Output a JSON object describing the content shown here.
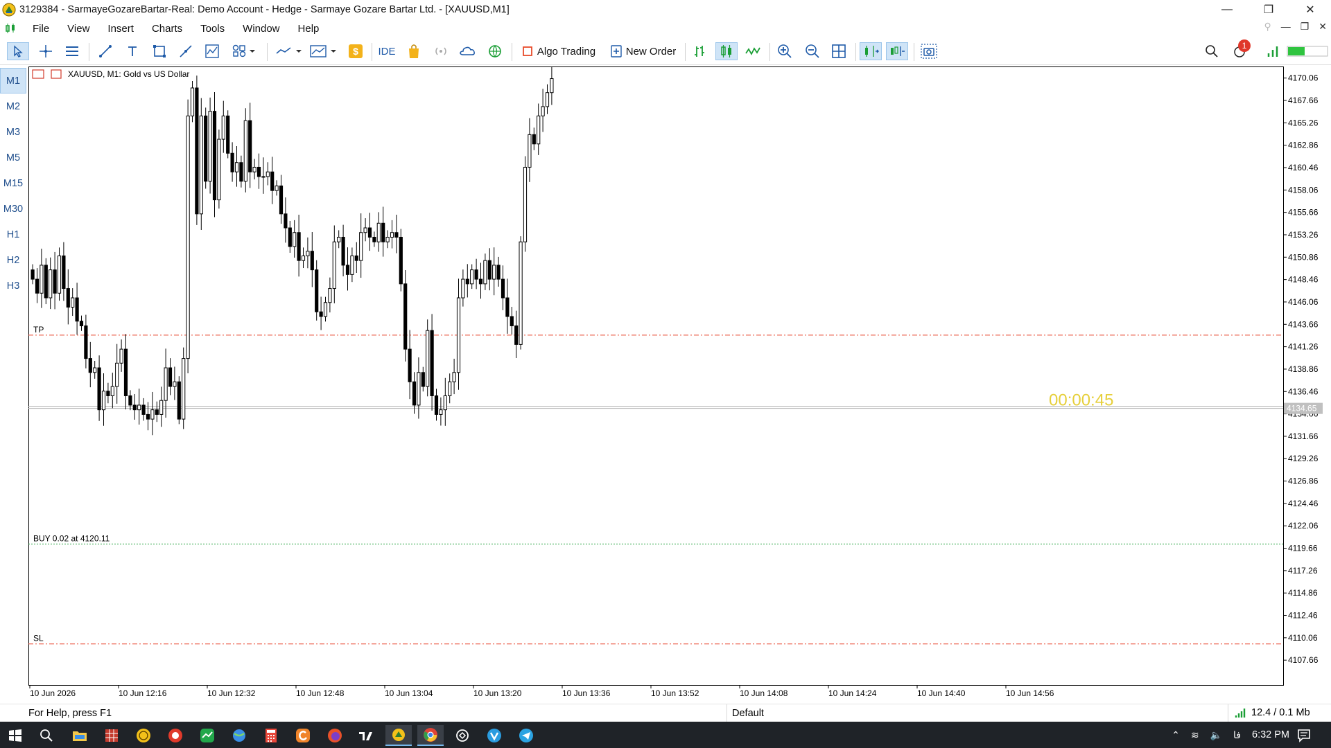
{
  "window": {
    "title": "3129384 - SarmayeGozareBartar-Real: Demo Account - Hedge - Sarmaye Gozare Bartar Ltd. - [XAUUSD,M1]",
    "minimize": "—",
    "maximize": "❐",
    "close": "✕"
  },
  "menu": {
    "items": [
      "File",
      "View",
      "Insert",
      "Charts",
      "Tools",
      "Window",
      "Help"
    ],
    "mdi": [
      "—",
      "❐",
      "✕"
    ]
  },
  "toolbar": {
    "ide_label": "IDE",
    "algo_label": "Algo Trading",
    "neworder_label": "New Order",
    "notification_count": "1"
  },
  "timeframes": {
    "items": [
      "M1",
      "M2",
      "M3",
      "M5",
      "M15",
      "M30",
      "H1",
      "H2",
      "H3"
    ],
    "active": "M1"
  },
  "chart": {
    "symbol_label": "XAUUSD, M1:  Gold vs US Dollar",
    "countdown": "00:00:45",
    "bid_label": "4134.65",
    "tp_label": "TP",
    "sl_label": "SL",
    "buy_label": "BUY 0.02 at 4120.11",
    "colors": {
      "tp_sl": "#e8412a",
      "buy": "#1a9e35",
      "countdown": "#e6cf3a",
      "candle": "#000000"
    }
  },
  "chart_data": {
    "type": "candlestick",
    "ylim": [
      4105.0,
      4171.3
    ],
    "price_ticks": [
      "4170.06",
      "4167.66",
      "4165.26",
      "4162.86",
      "4160.46",
      "4158.06",
      "4155.66",
      "4153.26",
      "4150.86",
      "4148.46",
      "4146.06",
      "4143.66",
      "4141.26",
      "4138.86",
      "4136.46",
      "4134.06",
      "4131.66",
      "4129.26",
      "4126.86",
      "4124.46",
      "4122.06",
      "4119.66",
      "4117.26",
      "4114.86",
      "4112.46",
      "4110.06",
      "4107.66"
    ],
    "time_ticks": [
      "10 Jun 2026",
      "10 Jun 12:16",
      "10 Jun 12:32",
      "10 Jun 12:48",
      "10 Jun 13:04",
      "10 Jun 13:20",
      "10 Jun 13:36",
      "10 Jun 13:52",
      "10 Jun 14:08",
      "10 Jun 14:24",
      "10 Jun 14:40",
      "10 Jun 14:56"
    ],
    "levels": {
      "tp": 4142.5,
      "buy": 4120.11,
      "sl": 4109.4,
      "bid": 4134.65
    },
    "closes": [
      4148.5,
      4147.0,
      4150.0,
      4146.5,
      4149.5,
      4147.0,
      4151.0,
      4147.5,
      4145.5,
      4146.5,
      4144.0,
      4143.5,
      4140.0,
      4138.5,
      4139.0,
      4134.5,
      4136.5,
      4136.0,
      4137.0,
      4139.5,
      4141.0,
      4136.0,
      4135.0,
      4134.5,
      4135.0,
      4134.0,
      4133.5,
      4134.5,
      4134.0,
      4135.5,
      4139.0,
      4137.0,
      4137.5,
      4133.5,
      4140.0,
      4166.0,
      4169.0,
      4155.5,
      4166.0,
      4159.0,
      4166.5,
      4157.0,
      4163.5,
      4166.0,
      4162.0,
      4160.0,
      4161.0,
      4159.0,
      4165.5,
      4160.0,
      4160.5,
      4159.5,
      4159.5,
      4160.0,
      4158.0,
      4158.5,
      4155.5,
      4154.0,
      4152.0,
      4153.5,
      4150.5,
      4151.0,
      4151.5,
      4149.5,
      4145.0,
      4144.5,
      4146.0,
      4147.5,
      4152.5,
      4153.0,
      4150.0,
      4149.0,
      4151.0,
      4150.5,
      4153.5,
      4154.0,
      4153.0,
      4152.5,
      4154.5,
      4152.5,
      4153.0,
      4153.5,
      4153.0,
      4148.0,
      4141.0,
      4137.5,
      4135.0,
      4138.5,
      4137.0,
      4143.0,
      4136.0,
      4134.0,
      4134.5,
      4136.0,
      4137.5,
      4138.5,
      4146.5,
      4148.5,
      4148.0,
      4149.5,
      4148.5,
      4148.0,
      4150.5,
      4148.5,
      4150.0,
      4148.5,
      4146.5,
      4144.5,
      4143.5,
      4141.5,
      4152.5,
      4160.5,
      4164.0,
      4163.0,
      4166.0,
      4167.0,
      4168.5,
      4170.0
    ]
  },
  "status": {
    "help": "For Help, press F1",
    "profile": "Default",
    "traffic": "12.4 / 0.1 Mb"
  },
  "taskbar": {
    "time": "6:32 PM",
    "lang": "فا"
  }
}
